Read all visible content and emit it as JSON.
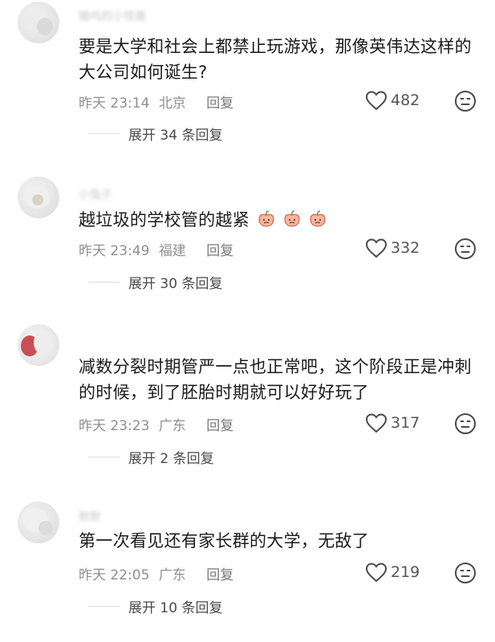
{
  "comments": [
    {
      "username": "嗷呜的小怪兽",
      "text_lines": [
        "要是大学和社会上都禁止玩游戏，那像英伟达这样的",
        "大公司如何诞生?"
      ],
      "time": "昨天 23:14",
      "location": "北京",
      "reply_label": "回复",
      "likes": "482",
      "expand_label": "展开 34 条回复"
    },
    {
      "username": "小兔子",
      "text_lines": [
        "越垃圾的学校管的越紧"
      ],
      "emoji": [
        "peach-emoji",
        "peach-emoji",
        "peach-emoji"
      ],
      "time": "昨天 23:49",
      "location": "福建",
      "reply_label": "回复",
      "likes": "332",
      "expand_label": "展开 30 条回复"
    },
    {
      "username": "",
      "text_lines": [
        "减数分裂时期管严一点也正常吧，这个阶段正是冲刺",
        "的时候，到了胚胎时期就可以好好玩了"
      ],
      "time": "昨天 23:23",
      "location": "广东",
      "reply_label": "回复",
      "likes": "317",
      "expand_label": "展开 2 条回复"
    },
    {
      "username": "默默",
      "text_lines": [
        "第一次看见还有家长群的大学，无敌了"
      ],
      "time": "昨天 22:05",
      "location": "广东",
      "reply_label": "回复",
      "likes": "219",
      "expand_label": "展开 10 条回复"
    }
  ],
  "icons": {
    "like": "heart-outline-icon",
    "dislike": "meh-face-icon"
  },
  "colors": {
    "meta_text": "#8f8f8f",
    "body_text": "#1b1b1b",
    "divider": "#dcdcdc"
  }
}
